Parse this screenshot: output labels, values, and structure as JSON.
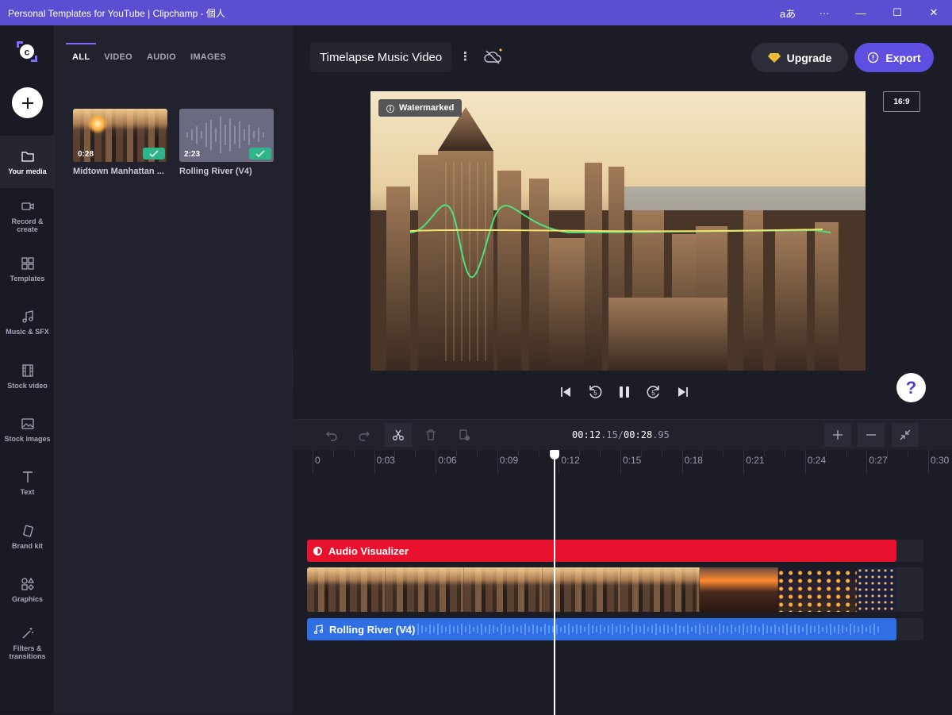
{
  "window": {
    "title": "Personal Templates for YouTube | Clipchamp - 個人",
    "lang_glyph": "aあ",
    "more_glyph": "···",
    "minimize_glyph": "—",
    "maximize_glyph": "☐",
    "close_glyph": "✕"
  },
  "nav": {
    "items": [
      {
        "label": "Your media",
        "icon": "folder-icon"
      },
      {
        "label": "Record & create",
        "icon": "camera-icon"
      },
      {
        "label": "Templates",
        "icon": "templates-icon"
      },
      {
        "label": "Music & SFX",
        "icon": "music-icon"
      },
      {
        "label": "Stock video",
        "icon": "film-icon"
      },
      {
        "label": "Stock images",
        "icon": "image-icon"
      },
      {
        "label": "Text",
        "icon": "text-icon"
      },
      {
        "label": "Brand kit",
        "icon": "brand-kit-icon"
      },
      {
        "label": "Graphics",
        "icon": "graphics-icon"
      },
      {
        "label": "Filters & transitions",
        "icon": "wand-icon"
      }
    ]
  },
  "media": {
    "tabs": [
      "ALL",
      "VIDEO",
      "AUDIO",
      "IMAGES"
    ],
    "items": [
      {
        "duration": "0:28",
        "title": "Midtown Manhattan ..."
      },
      {
        "duration": "2:23",
        "title": "Rolling River (V4)"
      }
    ]
  },
  "editor": {
    "project_title": "Timelapse Music Video",
    "kebab": "⋮",
    "upgrade_label": "Upgrade",
    "export_label": "Export",
    "ratio": "16:9",
    "watermark": "Watermarked",
    "help": "?"
  },
  "timeline": {
    "time_current_main": "00:12",
    "time_current_frac": ".15",
    "time_sep": "/",
    "time_total_main": "00:28",
    "time_total_frac": ".95",
    "ticks": [
      "0",
      "0:03",
      "0:06",
      "0:09",
      "0:12",
      "0:15",
      "0:18",
      "0:21",
      "0:24",
      "0:27",
      "0:30"
    ],
    "visualizer_label": "Audio Visualizer",
    "audio_label": "Rolling River (V4)"
  },
  "colors": {
    "titlebar": "#5b4ed1",
    "accent": "#5e4fe0",
    "visualizer_clip": "#e8122f",
    "audio_clip": "#2f6fe3",
    "check": "#2fb58a"
  }
}
